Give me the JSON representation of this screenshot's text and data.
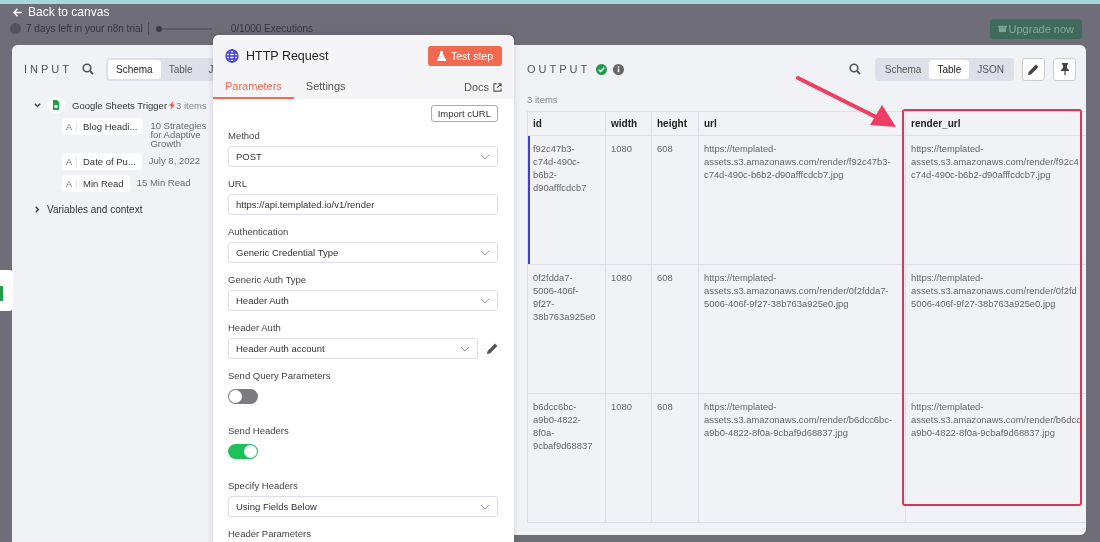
{
  "top_bar": {
    "back_link": "Back to canvas",
    "trial_text": "7 days left in your n8n trial",
    "executions": {
      "level": 0,
      "text": "0/1000 Executions"
    },
    "upgrade_button": "Upgrade now"
  },
  "input": {
    "title": "INPUT",
    "tabs": [
      {
        "label": "Schema",
        "selected": true
      },
      {
        "label": "Table",
        "selected": false
      },
      {
        "label": "J",
        "selected": false
      }
    ],
    "tree": [
      {
        "label": "Google Sheets Trigger",
        "badge": "3 items",
        "expanded": true,
        "fields": [
          {
            "type": "A",
            "name": "Blog Headi...",
            "value": "10 Strategies for Adaptive Growth"
          },
          {
            "type": "A",
            "name": "Date of Pu...",
            "value": "July 8, 2022"
          },
          {
            "type": "A",
            "name": "Min Read",
            "value": "15 Min Read"
          }
        ]
      },
      {
        "label": "Variables and context",
        "expanded": false
      }
    ]
  },
  "node": {
    "title": "HTTP Request",
    "test_button": "Test step",
    "tabs": [
      {
        "label": "Parameters",
        "selected": true
      },
      {
        "label": "Settings",
        "selected": false
      }
    ],
    "docs_link": "Docs",
    "import_button": "Import cURL",
    "params": [
      {
        "kind": "select",
        "label": "Method",
        "value": "POST"
      },
      {
        "kind": "input",
        "label": "URL",
        "value": "https://api.templated.io/v1/render"
      },
      {
        "kind": "select",
        "label": "Authentication",
        "value": "Generic Credential Type"
      },
      {
        "kind": "select",
        "label": "Generic Auth Type",
        "value": "Header Auth"
      },
      {
        "kind": "credential",
        "label": "Header Auth",
        "value": "Header Auth account"
      },
      {
        "kind": "toggle",
        "label": "Send Query Parameters",
        "on": false
      },
      {
        "kind": "toggle",
        "label": "Send Headers",
        "on": true
      },
      {
        "kind": "select",
        "label": "Specify Headers",
        "value": "Using Fields Below"
      },
      {
        "kind": "heading",
        "label": "Header Parameters"
      }
    ]
  },
  "output": {
    "title": "OUTPUT",
    "tabs": [
      {
        "label": "Schema",
        "selected": false
      },
      {
        "label": "Table",
        "selected": true
      },
      {
        "label": "JSON",
        "selected": false
      }
    ],
    "count": "3 items",
    "table": {
      "columns": [
        {
          "label": "id",
          "highlighted": false
        },
        {
          "label": "width",
          "highlighted": false
        },
        {
          "label": "height",
          "highlighted": false
        },
        {
          "label": "url",
          "highlighted": false
        },
        {
          "label": "render_url",
          "highlighted": true
        }
      ],
      "rows": [
        {
          "selected": true,
          "cells": [
            [
              "f92c47b3-",
              "c74d-490c-",
              "b6b2-",
              "d90afffcdcb7"
            ],
            [
              "1080"
            ],
            [
              "608"
            ],
            [
              "https://templated-",
              "assets.s3.amazonaws.com/render/f92c47b3-",
              "c74d-490c-b6b2-d90afffcdcb7.jpg"
            ],
            [
              "https://templated-",
              "assets.s3.amazonaws.com/render/f92c4",
              "c74d-490c-b6b2-d90afffcdcb7.jpg"
            ]
          ]
        },
        {
          "selected": false,
          "cells": [
            [
              "0f2fdda7-",
              "5006-406f-",
              "9f27-",
              "38b763a925e0"
            ],
            [
              "1080"
            ],
            [
              "608"
            ],
            [
              "https://templated-",
              "assets.s3.amazonaws.com/render/0f2fdda7-",
              "5006-406f-9f27-38b763a925e0.jpg"
            ],
            [
              "https://templated-",
              "assets.s3.amazonaws.com/render/0f2fd",
              "5006-406f-9f27-38b763a925e0.jpg"
            ]
          ]
        },
        {
          "selected": false,
          "cells": [
            [
              "b6dcc6bc-",
              "a9b0-4822-",
              "8f0a-",
              "9cbaf9d68837"
            ],
            [
              "1080"
            ],
            [
              "608"
            ],
            [
              "https://templated-",
              "assets.s3.amazonaws.com/render/b6dcc6bc-",
              "a9b0-4822-8f0a-9cbaf9d68837.jpg"
            ],
            [
              "https://templated-",
              "assets.s3.amazonaws.com/render/b6dcc",
              "a9b0-4822-8f0a-9cbaf9d68837.jpg"
            ]
          ]
        }
      ]
    }
  }
}
